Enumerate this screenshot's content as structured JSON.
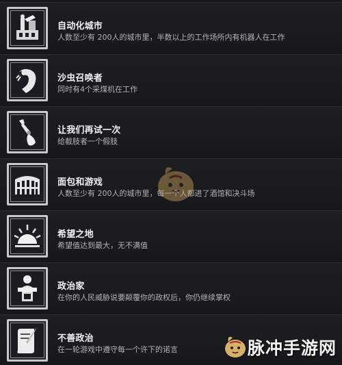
{
  "achievements": [
    {
      "title": "自动化城市",
      "desc": "人数至少有 200人的城市里，半数以上的工作场所内有机器人在工作",
      "icon": "robot-factory-icon"
    },
    {
      "title": "沙虫召唤者",
      "desc": "同时有4个采煤机在工作",
      "icon": "sandworm-icon"
    },
    {
      "title": "让我们再试一次",
      "desc": "给截肢者一个假肢",
      "icon": "prosthetic-arm-icon"
    },
    {
      "title": "面包和游戏",
      "desc": "人数至少有 200人的城市里，每一个人都进了酒馆和决斗场",
      "icon": "colosseum-icon"
    },
    {
      "title": "希望之地",
      "desc": "希望值达到最大，无不满值",
      "icon": "sunrise-icon"
    },
    {
      "title": "政治家",
      "desc": "在你的人民威胁说要颠覆你的政权后，你仍继续掌权",
      "icon": "podium-speaker-icon"
    },
    {
      "title": "不善政治",
      "desc": "在一轮游戏中遵守每一个许下的诺言",
      "icon": "scroll-quill-icon"
    }
  ],
  "watermark": {
    "text": "脉冲手游网"
  }
}
